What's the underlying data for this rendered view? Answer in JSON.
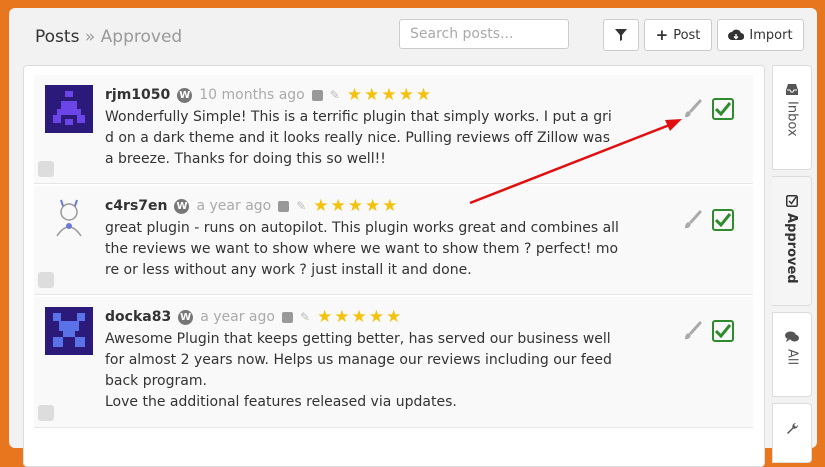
{
  "header": {
    "title": "Posts",
    "separator": "»",
    "crumb": "Approved",
    "search_placeholder": "Search posts...",
    "post_label": "Post",
    "import_label": "Import"
  },
  "reviews": [
    {
      "author": "rjm1050",
      "time": "10 months ago",
      "rating": 5,
      "text": "Wonderfully Simple! This is a terrific plugin that simply works. I put a grid on a dark theme and it looks really nice. Pulling reviews off Zillow was a breeze. Thanks for doing this so well!!"
    },
    {
      "author": "c4rs7en",
      "time": "a year ago",
      "rating": 5,
      "text": "great plugin - runs on autopilot. This plugin works great and combines all the reviews we want to show where we want to show them ? perfect! more or less without any work ? just install it and done."
    },
    {
      "author": "docka83",
      "time": "a year ago",
      "rating": 5,
      "text": "Awesome Plugin that keeps getting better, has served our business well for almost 2 years now. Helps us manage our reviews including our feedback program.",
      "text2": "Love the additional features released via updates."
    }
  ],
  "tabs": [
    {
      "label": "Inbox",
      "icon": "inbox-icon"
    },
    {
      "label": "Approved",
      "icon": "check-square-icon"
    },
    {
      "label": "All",
      "icon": "comments-icon"
    },
    {
      "label": "",
      "icon": "wrench-icon"
    }
  ],
  "colors": {
    "background": "#e8761f",
    "star": "#f4c20d",
    "approve": "#2e8b2e",
    "arrow": "#e01010"
  }
}
